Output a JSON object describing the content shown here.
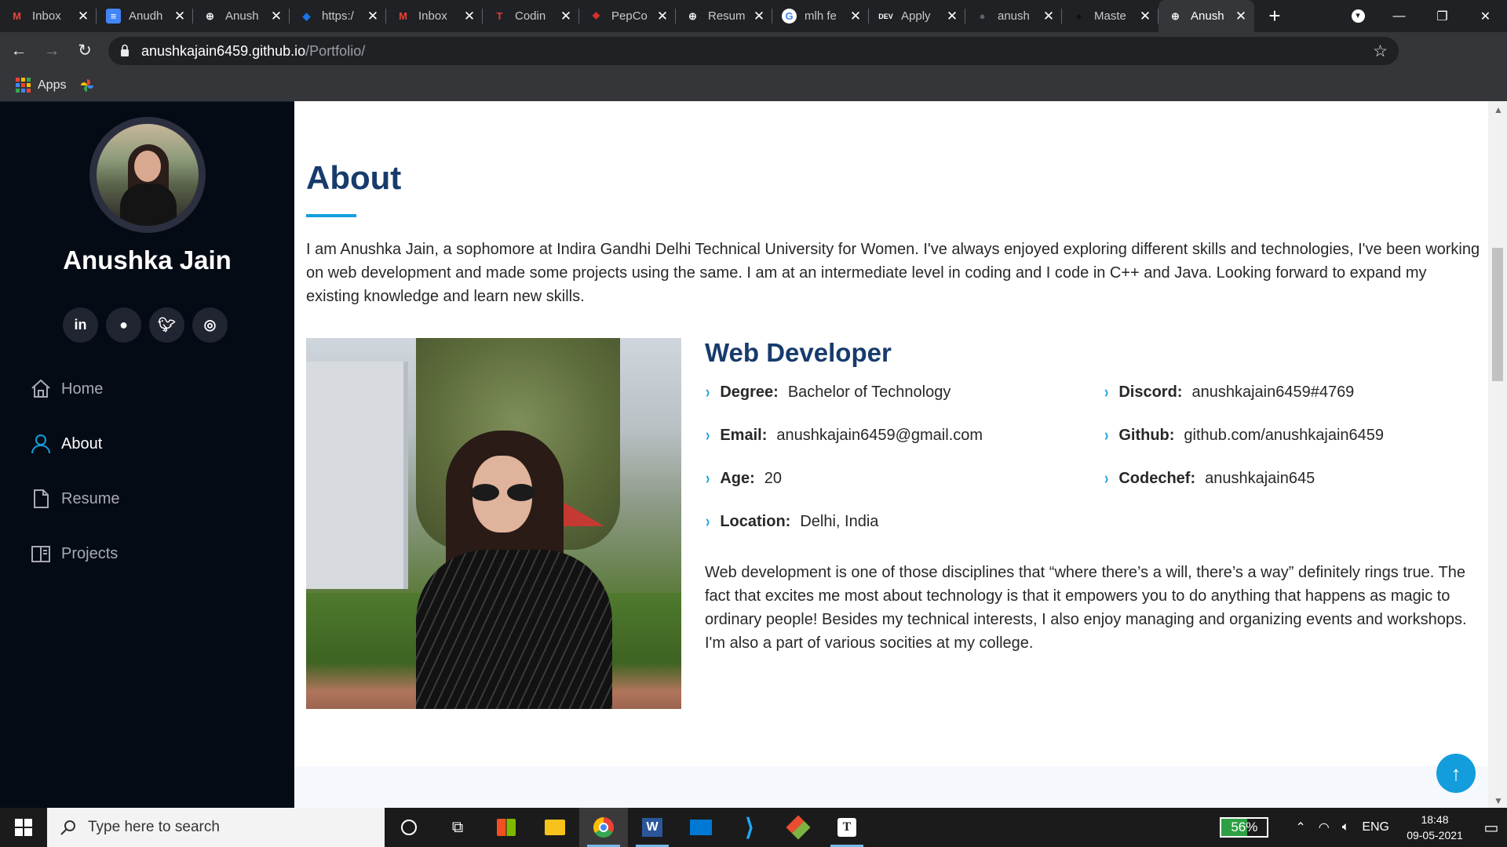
{
  "browser": {
    "tabs": [
      {
        "title": "Inbox",
        "icon": "gmail-icon",
        "color": "#ea4335"
      },
      {
        "title": "Anudh",
        "icon": "docs-icon",
        "color": "#4285f4"
      },
      {
        "title": "Anush",
        "icon": "globe-icon",
        "color": "#e8eaed"
      },
      {
        "title": "https:/",
        "icon": "diamond-icon",
        "color": "#1a73e8"
      },
      {
        "title": "Inbox",
        "icon": "gmail-icon",
        "color": "#ea4335"
      },
      {
        "title": "Codin",
        "icon": "tg-icon",
        "color": "#e53935"
      },
      {
        "title": "PepCo",
        "icon": "pepcoding-icon",
        "color": "#d32f2f"
      },
      {
        "title": "Resum",
        "icon": "globe-icon",
        "color": "#e8eaed"
      },
      {
        "title": "mlh fe",
        "icon": "google-icon",
        "color": "#ffffff"
      },
      {
        "title": "Apply",
        "icon": "dev-icon",
        "color": "#000000"
      },
      {
        "title": "anush",
        "icon": "github-icon",
        "color": "#5f6368"
      },
      {
        "title": "Maste",
        "icon": "github-icon",
        "color": "#202124"
      },
      {
        "title": "Anush",
        "icon": "globe-icon",
        "color": "#e8eaed",
        "active": true
      }
    ],
    "url_host": "anushkajain6459.github.io",
    "url_path": "/Portfolio/",
    "bookmarks": {
      "apps_label": "Apps"
    }
  },
  "sidebar": {
    "name": "Anushka Jain",
    "socials": [
      {
        "label": "in",
        "icon": "linkedin-icon"
      },
      {
        "label": "",
        "icon": "github-icon"
      },
      {
        "label": "",
        "icon": "twitter-icon"
      },
      {
        "label": "",
        "icon": "instagram-icon"
      }
    ],
    "nav": [
      {
        "label": "Home",
        "icon": "home-icon"
      },
      {
        "label": "About",
        "icon": "user-icon",
        "active": true
      },
      {
        "label": "Resume",
        "icon": "file-icon"
      },
      {
        "label": "Projects",
        "icon": "book-icon"
      }
    ]
  },
  "about": {
    "heading": "About",
    "intro": "I am Anushka Jain, a sophomore at Indira Gandhi Delhi Technical University for Women. I've always enjoyed exploring different skills and technologies, I've been working on web development and made some projects using the same. I am at an intermediate level in coding and I code in C++ and Java. Looking forward to expand my existing knowledge and learn new skills.",
    "role": "Web Developer",
    "facts": [
      {
        "label": "Degree:",
        "value": "Bachelor of Technology"
      },
      {
        "label": "Email:",
        "value": "anushkajain6459@gmail.com"
      },
      {
        "label": "Age:",
        "value": "20"
      },
      {
        "label": "Location:",
        "value": "Delhi, India"
      },
      {
        "label": "Discord:",
        "value": "anushkajain6459#4769"
      },
      {
        "label": "Github:",
        "value": "github.com/anushkajain6459"
      },
      {
        "label": "Codechef:",
        "value": "anushkajain645"
      }
    ],
    "outro": "Web development is one of those disciplines that “where there’s a will, there’s a way” definitely rings true. The fact that excites me most about technology is that it empowers you to do anything that happens as magic to ordinary people! Besides my technical interests, I also enjoy managing and organizing events and workshops. I'm also a part of various socities at my college."
  },
  "taskbar": {
    "search_placeholder": "Type here to search",
    "battery": "56%",
    "battery_level": 0.56,
    "language": "ENG",
    "time": "18:48",
    "date": "09-05-2021"
  }
}
